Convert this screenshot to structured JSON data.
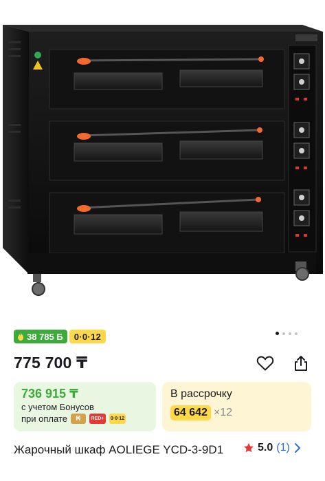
{
  "product_image": {
    "alt": "product-photo"
  },
  "carousel": {
    "total": 4,
    "active": 1
  },
  "badges": {
    "bonus": "38 785 Б",
    "installment": "0·0·12"
  },
  "price": {
    "main": "775 700 ₸"
  },
  "bonus_card": {
    "price": "736 915 ₸",
    "line1": "с учетом Бонусов",
    "line2": "при оплате",
    "kaspi_mark": "₭",
    "red_mark": "RED+",
    "zero_mark": "0·0·12"
  },
  "installment_card": {
    "title": "В рассрочку",
    "monthly": "64 642",
    "months": "×12"
  },
  "product": {
    "title": "Жарочный шкаф AOLIEGE YCD-3-9D1",
    "rating": "5.0",
    "reviews": "(1)"
  },
  "colors": {
    "green": "#3dab3a",
    "yellow": "#ffd84a",
    "link": "#2e6fd9",
    "star": "#e53935"
  },
  "icons": [
    "flame-icon",
    "heart-icon",
    "share-icon",
    "star-icon",
    "chevron-right-icon"
  ]
}
